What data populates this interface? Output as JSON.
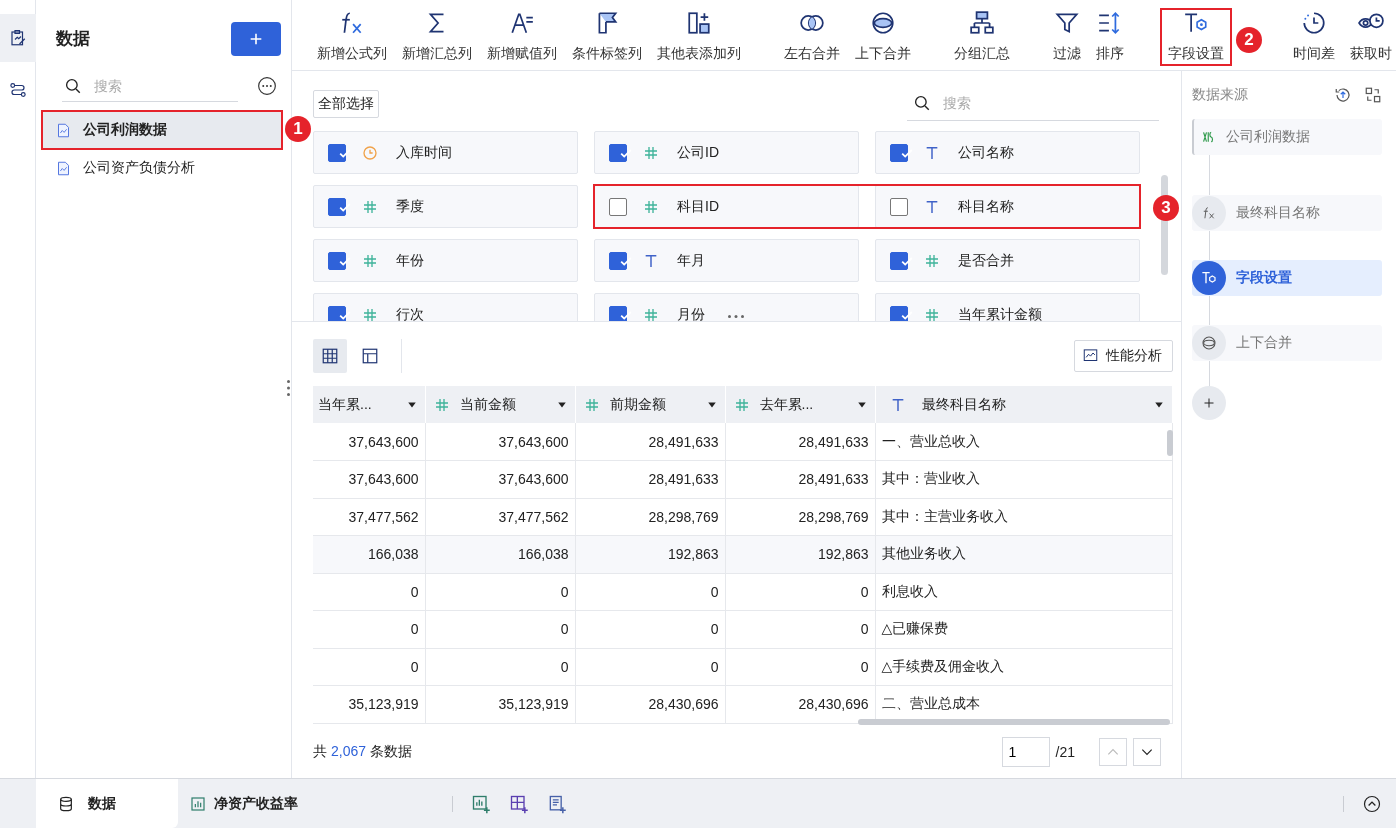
{
  "rail": {
    "items": [
      {
        "kind": "edit",
        "selected": true
      },
      {
        "kind": "flow",
        "selected": false
      }
    ]
  },
  "sidebar": {
    "title": "数据",
    "search": {
      "placeholder": "搜索"
    },
    "items": [
      {
        "label": "公司利润数据",
        "selected": true,
        "callout": "1"
      },
      {
        "label": "公司资产负债分析",
        "selected": false
      }
    ]
  },
  "toolbar": {
    "groups": [
      [
        {
          "kind": "formula",
          "label": "新增公式列"
        },
        {
          "kind": "sum",
          "label": "新增汇总列"
        },
        {
          "kind": "assign",
          "label": "新增赋值列"
        },
        {
          "kind": "tag",
          "label": "条件标签列"
        },
        {
          "kind": "addcol",
          "label": "其他表添加列"
        }
      ],
      [
        {
          "kind": "hmerge",
          "label": "左右合并"
        },
        {
          "kind": "vmerge",
          "label": "上下合并"
        }
      ],
      [
        {
          "kind": "group",
          "label": "分组汇总"
        }
      ],
      [
        {
          "kind": "filter",
          "label": "过滤"
        },
        {
          "kind": "sort",
          "label": "排序"
        }
      ],
      [
        {
          "kind": "fieldset",
          "label": "字段设置",
          "callout": "2"
        }
      ],
      [
        {
          "kind": "timediff",
          "label": "时间差"
        },
        {
          "kind": "timeget",
          "label": "获取时"
        }
      ]
    ]
  },
  "fields": {
    "select_all": "全部选择",
    "search": {
      "placeholder": "搜索"
    },
    "rows": [
      {
        "items": [
          {
            "kind": "time",
            "label": "入库时间",
            "checked": true,
            "outlined": false
          },
          {
            "kind": "number",
            "label": "公司ID",
            "checked": true,
            "outlined": false
          },
          {
            "kind": "text",
            "label": "公司名称",
            "checked": true,
            "outlined": false
          }
        ]
      },
      {
        "callout": "3",
        "items": [
          {
            "kind": "number",
            "label": "季度",
            "checked": true,
            "outlined": false
          },
          {
            "kind": "number",
            "label": "科目ID",
            "checked": false,
            "outlined": true
          },
          {
            "kind": "text",
            "label": "科目名称",
            "checked": false,
            "outlined": true
          }
        ]
      },
      {
        "items": [
          {
            "kind": "number",
            "label": "年份",
            "checked": true,
            "outlined": false
          },
          {
            "kind": "text",
            "label": "年月",
            "checked": true,
            "outlined": false
          },
          {
            "kind": "number",
            "label": "是否合并",
            "checked": true,
            "outlined": false
          }
        ]
      },
      {
        "items": [
          {
            "kind": "number",
            "label": "行次",
            "checked": true,
            "outlined": false
          },
          {
            "kind": "number",
            "label": "月份",
            "checked": true,
            "outlined": false
          },
          {
            "kind": "number",
            "label": "当年累计金额",
            "checked": true,
            "outlined": false
          }
        ]
      }
    ]
  },
  "preview": {
    "views": [
      {
        "kind": "grid",
        "selected": true
      },
      {
        "kind": "layout",
        "selected": false
      }
    ],
    "perf_button": "性能分析",
    "table": {
      "columns": [
        {
          "kind": "number",
          "label": "当年累...",
          "icon_cut": true
        },
        {
          "kind": "number",
          "label": "当前金额",
          "icon_cut": false
        },
        {
          "kind": "number",
          "label": "前期金额",
          "icon_cut": false
        },
        {
          "kind": "number",
          "label": "去年累...",
          "icon_cut": false
        },
        {
          "kind": "text",
          "label": "最终科目名称",
          "icon_cut": false
        }
      ],
      "rows": [
        [
          "37,643,600",
          "37,643,600",
          "28,491,633",
          "28,491,633",
          "一、营业总收入"
        ],
        [
          "37,643,600",
          "37,643,600",
          "28,491,633",
          "28,491,633",
          "其中：营业收入"
        ],
        [
          "37,477,562",
          "37,477,562",
          "28,298,769",
          "28,298,769",
          "其中：主营业务收入"
        ],
        [
          "166,038",
          "166,038",
          "192,863",
          "192,863",
          "其他业务收入"
        ],
        [
          "0",
          "0",
          "0",
          "0",
          "利息收入"
        ],
        [
          "0",
          "0",
          "0",
          "0",
          "△已赚保费"
        ],
        [
          "0",
          "0",
          "0",
          "0",
          "△手续费及佣金收入"
        ],
        [
          "35,123,919",
          "35,123,919",
          "28,430,696",
          "28,430,696",
          "二、营业总成本"
        ]
      ]
    },
    "footer": {
      "prefix": "共",
      "count": "2,067",
      "suffix": "条数据",
      "page": "1",
      "pages": "/21"
    }
  },
  "steps_panel": {
    "title": "数据来源",
    "steps": [
      {
        "kind": "source",
        "label": "公司利润数据",
        "selected": false
      },
      {
        "kind": "formula",
        "label": "最终科目名称",
        "selected": false
      },
      {
        "kind": "fieldset",
        "label": "字段设置",
        "selected": true
      },
      {
        "kind": "vmerge",
        "label": "上下合并",
        "selected": false
      }
    ]
  },
  "bottom_tabs": [
    {
      "kind": "data",
      "label": "数据",
      "selected": true
    },
    {
      "kind": "chart",
      "label": "净资产收益率",
      "selected": false
    }
  ]
}
